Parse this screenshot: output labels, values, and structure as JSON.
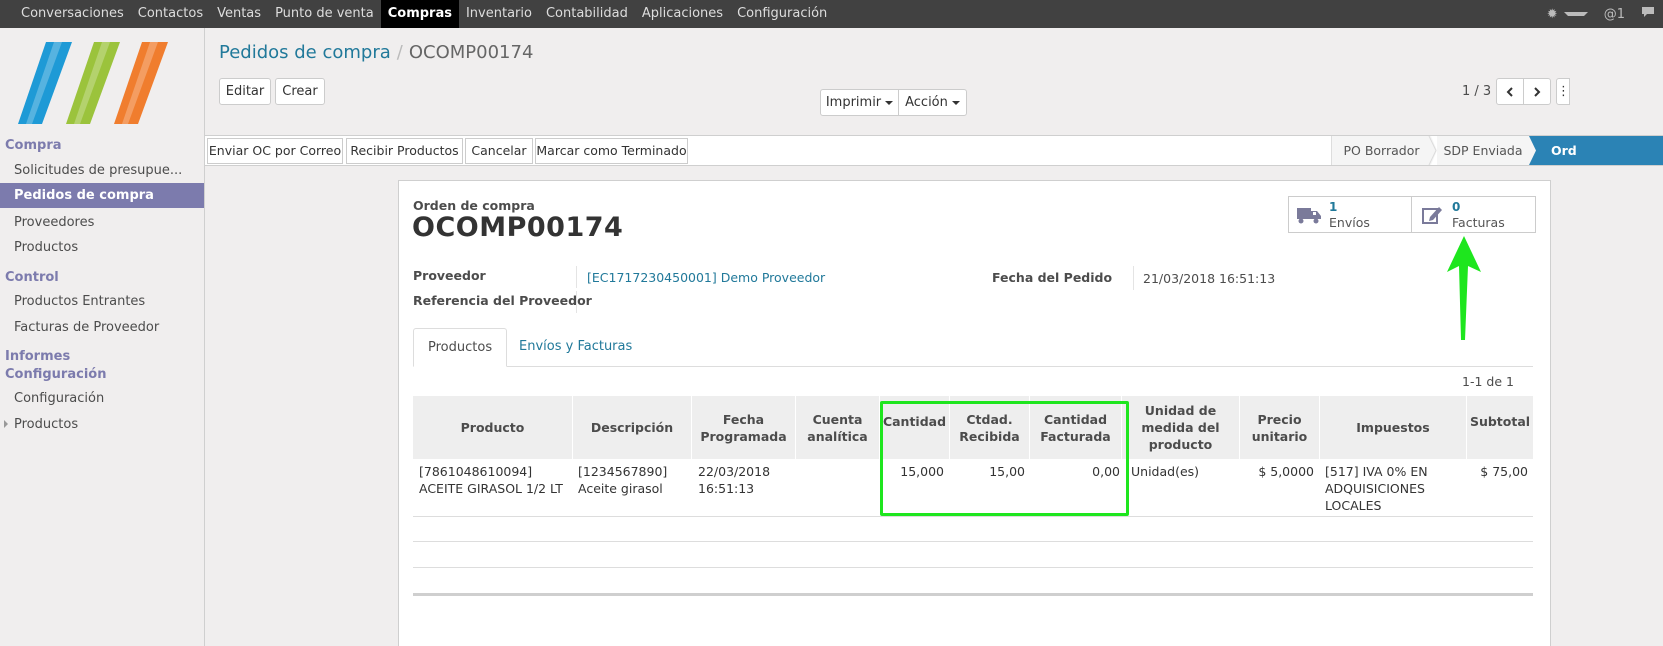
{
  "topbar": {
    "menu": [
      "Conversaciones",
      "Contactos",
      "Ventas",
      "Punto de venta",
      "Compras",
      "Inventario",
      "Contabilidad",
      "Aplicaciones",
      "Configuración"
    ],
    "active_index": 4,
    "user_text": "@1"
  },
  "sidebar": {
    "sections": [
      {
        "label": "Compra",
        "items": [
          "Solicitudes de presupue...",
          "Pedidos de compra",
          "Proveedores",
          "Productos"
        ]
      },
      {
        "label": "Control",
        "items": [
          "Productos Entrantes",
          "Facturas de Proveedor"
        ]
      },
      {
        "label": "Informes",
        "items": []
      },
      {
        "label": "Configuración",
        "items": [
          "Configuración",
          "Productos"
        ]
      }
    ],
    "active_item": "Pedidos de compra",
    "logo_colors": [
      "#1e9ad6",
      "#9bc33c",
      "#f07d2e"
    ]
  },
  "breadcrumb": {
    "parent": "Pedidos de compra",
    "separator": "/",
    "current": "OCOMP00174"
  },
  "buttons": {
    "edit": "Editar",
    "create": "Crear",
    "print": "Imprimir",
    "action": "Acción"
  },
  "pager": {
    "text": "1 / 3"
  },
  "statusbar": {
    "actions": [
      "Enviar OC por Correo",
      "Recibir Productos",
      "Cancelar",
      "Marcar como Terminado"
    ],
    "stages": [
      "PO Borrador",
      "SDP Enviada",
      "Orden de compra"
    ],
    "active_stage": "Orden de compra",
    "active_stage_visible": "Ord"
  },
  "smart_buttons": [
    {
      "count": "1",
      "label": "Envíos",
      "icon": "truck-icon"
    },
    {
      "count": "0",
      "label": "Facturas",
      "icon": "edit-icon"
    }
  ],
  "form": {
    "doc_type": "Orden de compra",
    "doc_name": "OCOMP00174",
    "supplier_label": "Proveedor",
    "supplier_value": "[EC1717230450001] Demo Proveedor",
    "supplier_ref_label": "Referencia del Proveedor",
    "order_date_label": "Fecha del Pedido",
    "order_date_value": "21/03/2018 16:51:13"
  },
  "tabs": [
    "Productos",
    "Envíos y Facturas"
  ],
  "record_count": "1-1 de 1",
  "table": {
    "headers": [
      "Producto",
      "Descripción",
      "Fecha Programada",
      "Cuenta analítica",
      "Cantidad",
      "Ctdad. Recibida",
      "Cantidad Facturada",
      "Unidad de medida del producto",
      "Precio unitario",
      "Impuestos",
      "Subtotal"
    ],
    "rows": [
      [
        "[7861048610094] ACEITE GIRASOL 1/2 LT",
        "[1234567890] Aceite girasol",
        "22/03/2018 16:51:13",
        "",
        "15,000",
        "15,00",
        "0,00",
        "Unidad(es)",
        "$ 5,0000",
        "[517] IVA 0% EN ADQUISICIONES LOCALES",
        "$ 75,00"
      ]
    ]
  },
  "annotations": {
    "highlight_color": "#1ee61e",
    "arrow_color": "#1ee61e"
  }
}
